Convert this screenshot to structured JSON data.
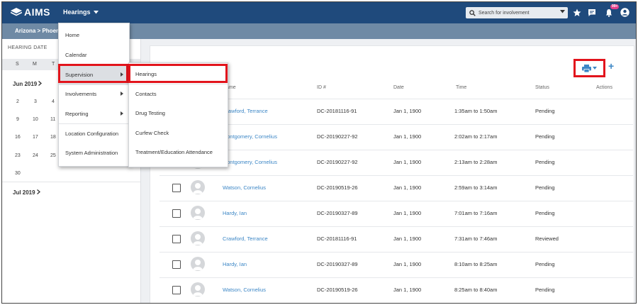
{
  "app": {
    "name": "AIMS",
    "module": "Hearings"
  },
  "search": {
    "placeholder": "Search for involvement"
  },
  "notifications": {
    "badge": "99+"
  },
  "breadcrumb": "Arizona > Phoen",
  "sidebar": {
    "title": "HEARING DATE",
    "weekdays": [
      "S",
      "M",
      "T"
    ],
    "month1": "Jun 2019",
    "month2": "Jul 2019",
    "days": [
      "2",
      "3",
      "4",
      "9",
      "10",
      "11",
      "16",
      "17",
      "18",
      "23",
      "24",
      "25",
      "30"
    ]
  },
  "menu": {
    "items": [
      "Home",
      "Calendar",
      "Supervision",
      "Involvements",
      "Reporting",
      "Location Configuration",
      "System Administration"
    ]
  },
  "submenu": {
    "items": [
      "Hearings",
      "Contacts",
      "Drug Testing",
      "Curfew Check",
      "Treatment/Education Attendance"
    ]
  },
  "table": {
    "headers": {
      "name": "Name",
      "id": "ID #",
      "date": "Date",
      "time": "Time",
      "status": "Status",
      "actions": "Actions"
    },
    "rows": [
      {
        "name": "Crawford, Terrance",
        "id": "DC-20181116-91",
        "date": "Jan 1, 1900",
        "time": "1:35am to 1:50am",
        "status": "Pending"
      },
      {
        "name": "Montgomery, Cornelius",
        "id": "DC-20190227-92",
        "date": "Jan 1, 1900",
        "time": "2:02am to 2:17am",
        "status": "Pending"
      },
      {
        "name": "Montgomery, Cornelius",
        "id": "DC-20190227-92",
        "date": "Jan 1, 1900",
        "time": "2:13am to 2:28am",
        "status": "Pending"
      },
      {
        "name": "Watson, Cornelius",
        "id": "DC-20190519-26",
        "date": "Jan 1, 1900",
        "time": "2:59am to 3:14am",
        "status": "Pending"
      },
      {
        "name": "Hardy, Ian",
        "id": "DC-20190327-89",
        "date": "Jan 1, 1900",
        "time": "7:01am to 7:16am",
        "status": "Pending"
      },
      {
        "name": "Crawford, Terrance",
        "id": "DC-20181116-91",
        "date": "Jan 1, 1900",
        "time": "7:31am to 7:46am",
        "status": "Reviewed"
      },
      {
        "name": "Hardy, Ian",
        "id": "DC-20190327-89",
        "date": "Jan 1, 1900",
        "time": "8:10am to 8:25am",
        "status": "Pending"
      },
      {
        "name": "Watson, Cornelius",
        "id": "DC-20190519-26",
        "date": "Jan 1, 1900",
        "time": "8:25am to 8:40am",
        "status": "Pending"
      }
    ]
  },
  "icons": {
    "logo": "aims-logo-icon",
    "print": "print-icon",
    "add": "plus-icon",
    "star": "star-icon",
    "chat": "chat-icon",
    "bell": "bell-icon",
    "user": "user-icon"
  },
  "colors": {
    "topbar": "#1f4a7c",
    "subbar": "#6f8aa5",
    "link": "#3d87c6",
    "highlight": "#e2141c",
    "badge": "#e43f8a"
  }
}
